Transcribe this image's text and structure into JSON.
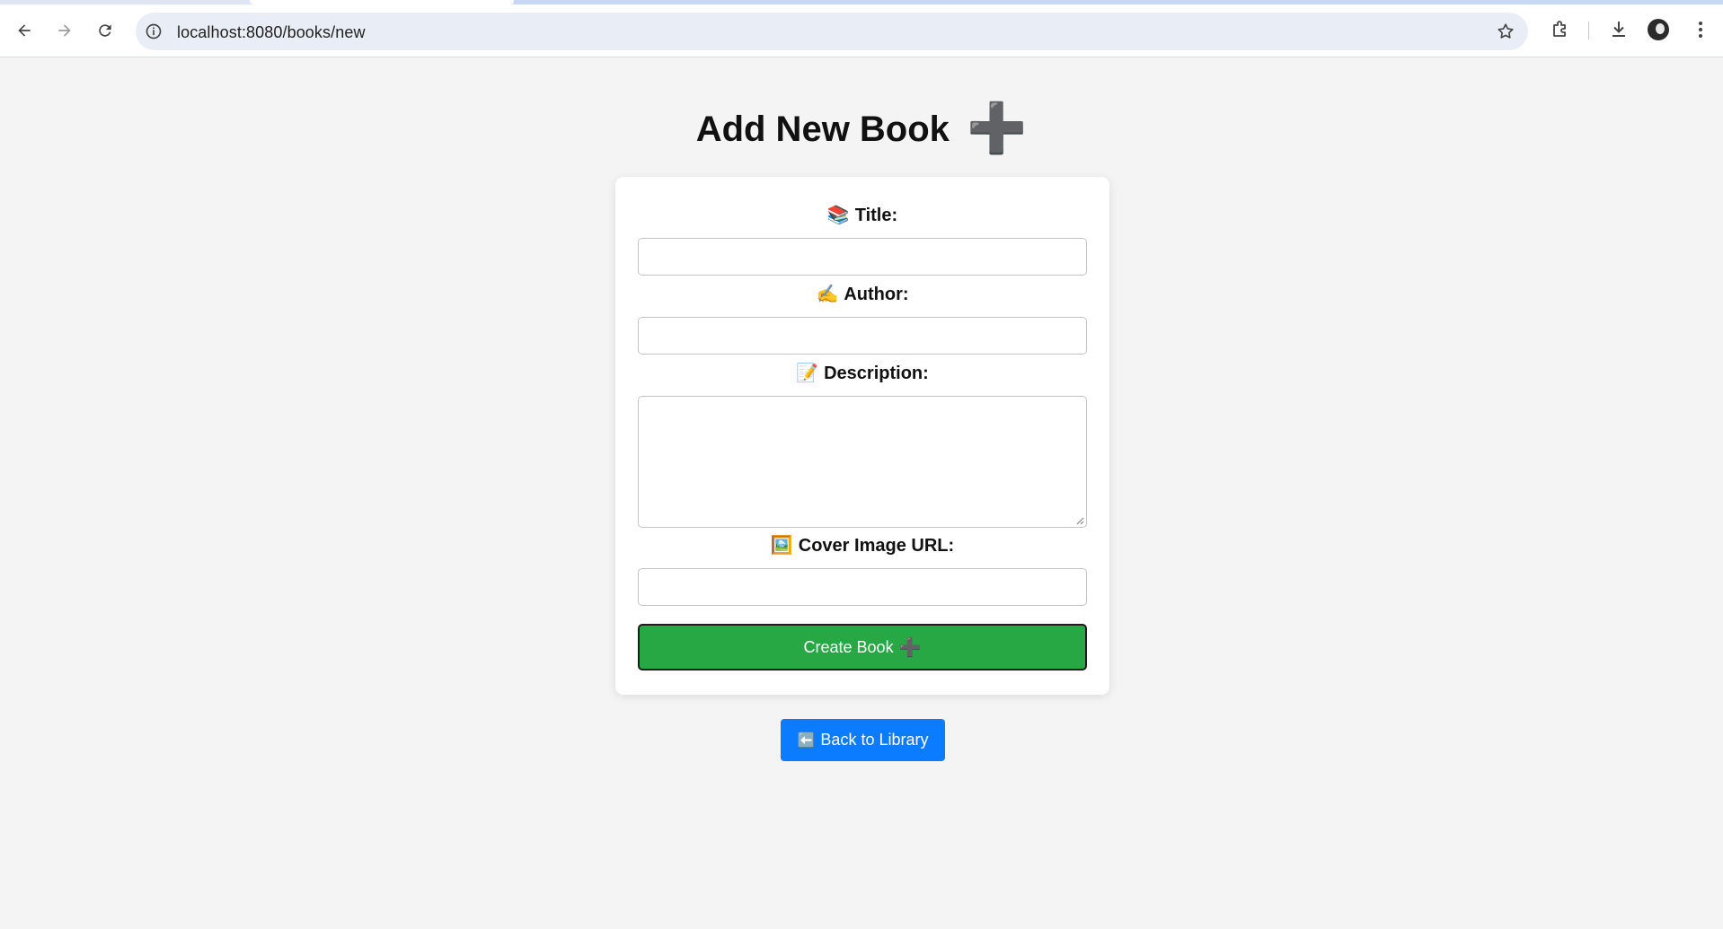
{
  "browser": {
    "url": "localhost:8080/books/new",
    "icons": [
      "back-arrow-icon",
      "forward-arrow-icon",
      "reload-icon",
      "site-info-icon",
      "bookmark-star-icon",
      "extensions-icon",
      "download-icon",
      "profile-avatar-icon",
      "more-menu-icon"
    ]
  },
  "page": {
    "title": "Add New Book",
    "title_icon": "➕",
    "accent_color": "#7e57c2"
  },
  "form": {
    "fields": [
      {
        "emoji": "📚",
        "label": "Title:",
        "value": ""
      },
      {
        "emoji": "✍️",
        "label": "Author:",
        "value": ""
      },
      {
        "emoji": "📝",
        "label": "Description:",
        "value": ""
      },
      {
        "emoji": "🖼️",
        "label": "Cover Image URL:",
        "value": ""
      }
    ],
    "submit": {
      "label": "Create Book",
      "icon": "➕",
      "color": "#28a745"
    }
  },
  "back": {
    "icon": "⬅️",
    "label": "Back to Library",
    "color": "#0b7cff"
  }
}
